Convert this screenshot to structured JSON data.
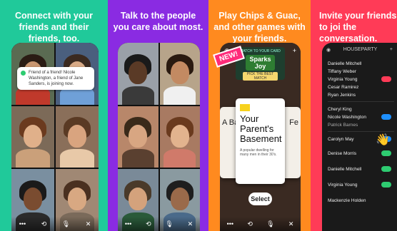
{
  "panels": [
    {
      "heading": "Connect with your friends and their friends, too.",
      "toast": "Friend of a friend! Nicole Washington, a friend of Jane Sanders, is joining now."
    },
    {
      "heading": "Talk to the people you care about most."
    },
    {
      "heading": "Play Chips & Guac, and other games with your friends.",
      "new_badge": "NEW!",
      "game": {
        "top_caption": "MATCH TO YOUR CARD",
        "top_word": "Sparks Joy",
        "pick_label": "PICK THE BEST MATCH",
        "card_title": "Your Parent's Basement",
        "card_desc": "A popular dwelling for many men in their 30's.",
        "side_left": "A Ba",
        "side_right": "Fe",
        "select_label": "Select"
      }
    },
    {
      "heading": "Invite your friends to joi the conversation.",
      "list_title": "HOUSEPARTY",
      "contacts": [
        {
          "name": "Danielle Mitchell"
        },
        {
          "name": "Tiffany Weber"
        },
        {
          "name": "Virginia Young"
        },
        {
          "name": "Cesar Ramirez"
        },
        {
          "name": "Ryan Jenkins"
        },
        {
          "name": "Cheryl King"
        },
        {
          "name": "Nicole Washington"
        },
        {
          "name": "Patrick Barnes"
        },
        {
          "name": "Carolyn May"
        },
        {
          "name": "Denise Morris"
        },
        {
          "name": "Danielle Mitchell"
        },
        {
          "name": "Virginia Young"
        },
        {
          "name": "Mackenzie Holden"
        }
      ]
    }
  ],
  "colors": {
    "panel1": "#20c99a",
    "panel2": "#8a2be2",
    "panel3": "#ff8a1f",
    "panel4": "#ff3b57"
  }
}
